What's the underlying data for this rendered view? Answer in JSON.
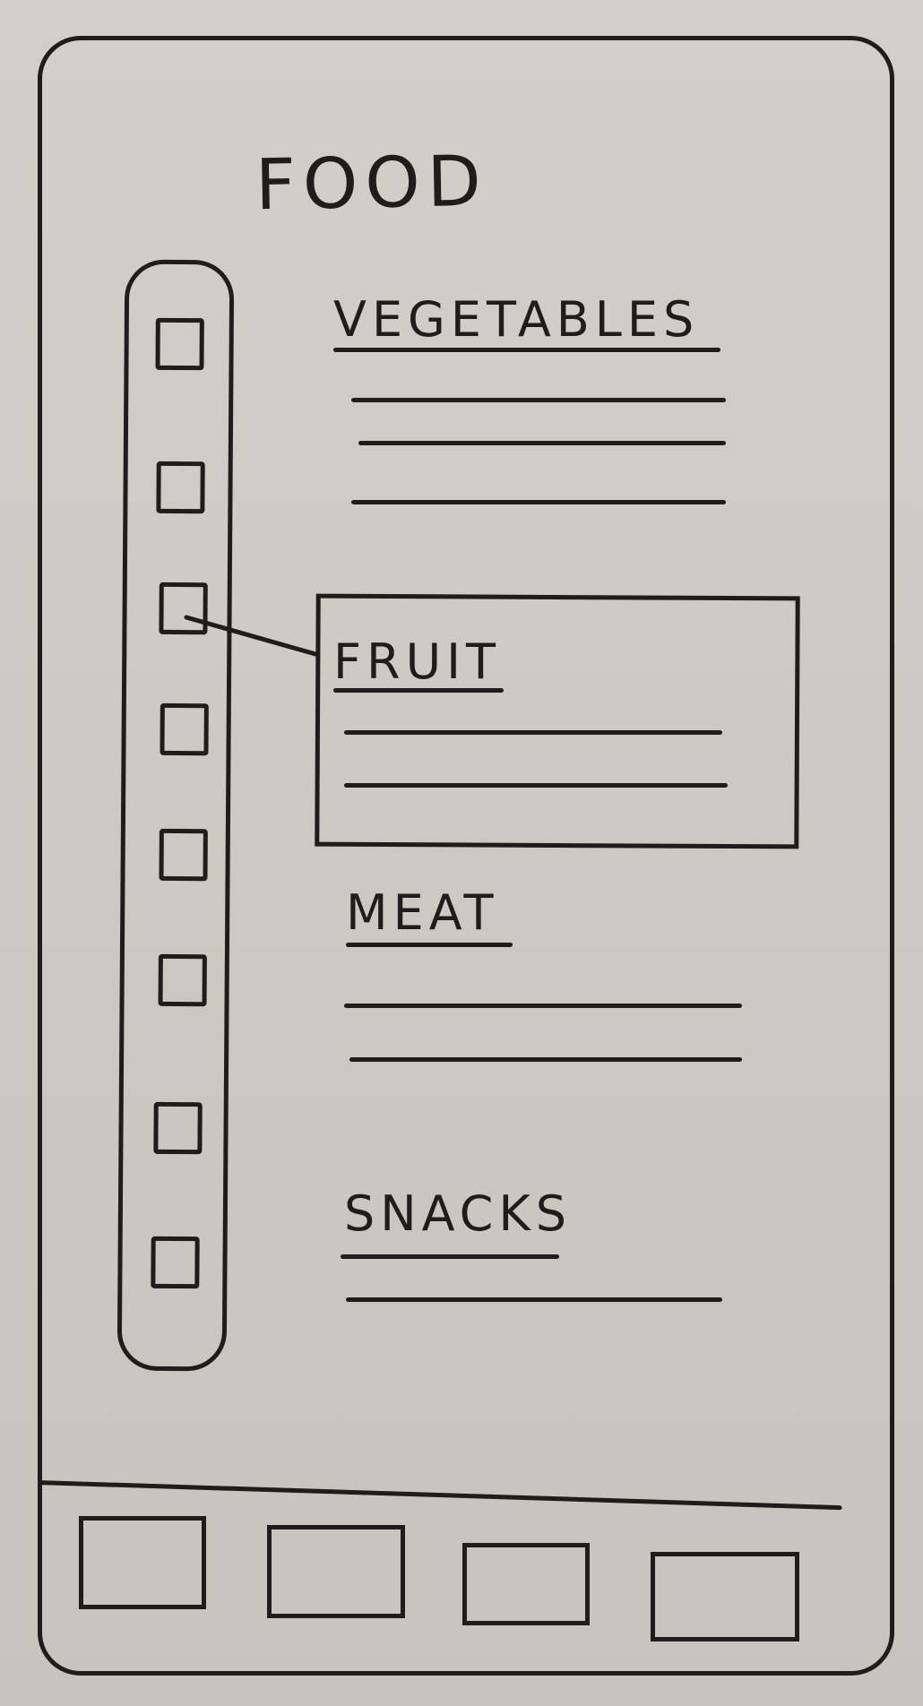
{
  "app": {
    "title": "FOOD"
  },
  "sidebar": {
    "items": [
      {
        "icon": "square-icon"
      },
      {
        "icon": "square-icon"
      },
      {
        "icon": "square-icon"
      },
      {
        "icon": "square-icon"
      },
      {
        "icon": "square-icon"
      },
      {
        "icon": "square-icon"
      },
      {
        "icon": "square-icon"
      },
      {
        "icon": "square-icon"
      }
    ]
  },
  "sections": [
    {
      "title": "VEGETABLES"
    },
    {
      "title": "FRUIT"
    },
    {
      "title": "MEAT"
    },
    {
      "title": "SNACKS"
    }
  ],
  "bottom_nav": {
    "tabs": [
      {
        "icon": "square-icon"
      },
      {
        "icon": "square-icon"
      },
      {
        "icon": "square-icon"
      },
      {
        "icon": "square-icon"
      }
    ]
  },
  "colors": {
    "paper": "#cfccc6",
    "ink": "#1f1d1b"
  }
}
